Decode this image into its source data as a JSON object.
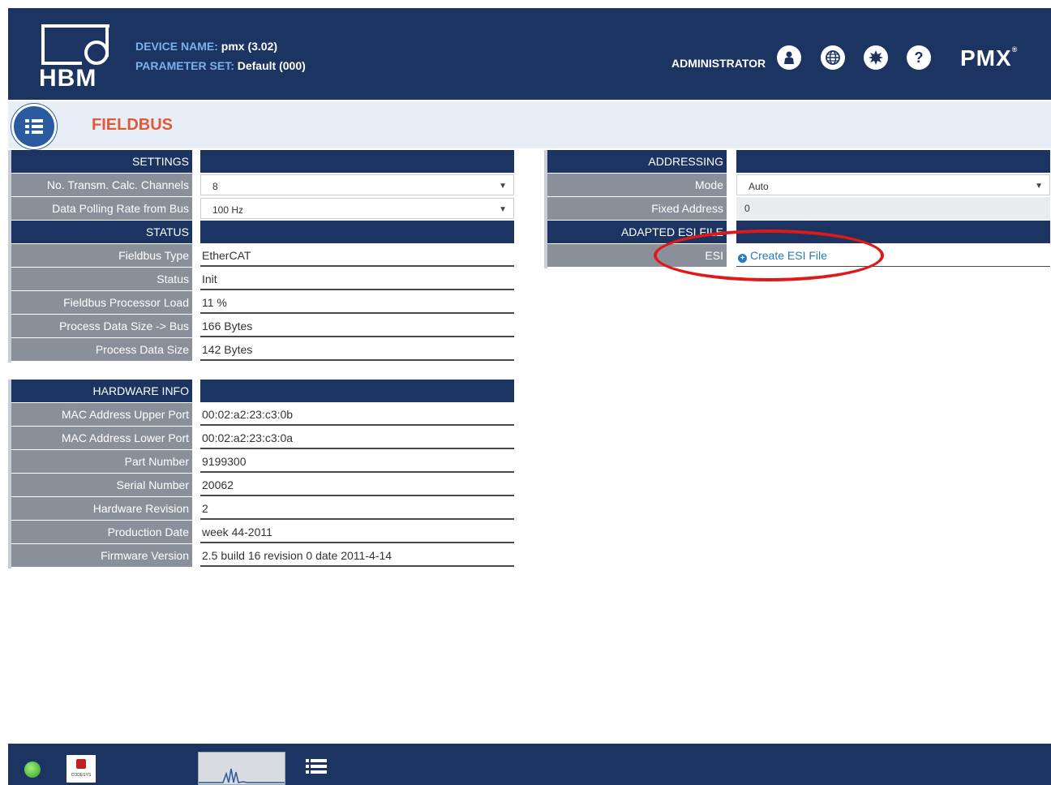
{
  "header": {
    "logo_text": "HBM",
    "device_name_label": "DEVICE NAME:",
    "device_name_value": "pmx (3.02)",
    "parameter_set_label": "PARAMETER SET:",
    "parameter_set_value": "Default (000)",
    "user": "ADMINISTRATOR",
    "icons": [
      "user-icon",
      "globe-icon",
      "settings-burst-icon",
      "help-icon"
    ],
    "help_glyph": "?",
    "brand": "PMX",
    "brand_mark": "®"
  },
  "page": {
    "title": "FIELDBUS"
  },
  "settings": {
    "header": "SETTINGS",
    "rows": [
      {
        "label": "No. Transm. Calc. Channels",
        "value": "8"
      },
      {
        "label": "Data Polling Rate from Bus",
        "value": "100 Hz"
      }
    ]
  },
  "status": {
    "header": "STATUS",
    "rows": [
      {
        "label": "Fieldbus Type",
        "value": "EtherCAT"
      },
      {
        "label": "Status",
        "value": "Init"
      },
      {
        "label": "Fieldbus Processor Load",
        "value": "11 %"
      },
      {
        "label": "Process Data Size -> Bus",
        "value": "166 Bytes"
      },
      {
        "label": "Process Data Size",
        "value": "142 Bytes"
      }
    ]
  },
  "hardware": {
    "header": "HARDWARE INFO",
    "rows": [
      {
        "label": "MAC Address Upper Port",
        "value": "00:02:a2:23:c3:0b"
      },
      {
        "label": "MAC Address Lower Port",
        "value": "00:02:a2:23:c3:0a"
      },
      {
        "label": "Part Number",
        "value": "9199300"
      },
      {
        "label": "Serial Number",
        "value": "20062"
      },
      {
        "label": "Hardware Revision",
        "value": "2"
      },
      {
        "label": "Production Date",
        "value": "week 44-2011"
      },
      {
        "label": "Firmware Version",
        "value": "2.5 build 16 revision 0 date 2011-4-14"
      }
    ]
  },
  "addressing": {
    "header": "ADDRESSING",
    "rows": [
      {
        "label": "Mode",
        "value": "Auto"
      },
      {
        "label": "Fixed Address",
        "value": "0"
      }
    ]
  },
  "esi": {
    "header": "ADAPTED ESI FILE",
    "label": "ESI",
    "link": "Create ESI File"
  },
  "footer": {
    "codesys_label": "CODESYS"
  },
  "colors": {
    "header_bg": "#1c3461",
    "label_bg": "#8a9099",
    "title": "#e05a3a",
    "link": "#2a7ab8",
    "highlight": "#e01818"
  }
}
